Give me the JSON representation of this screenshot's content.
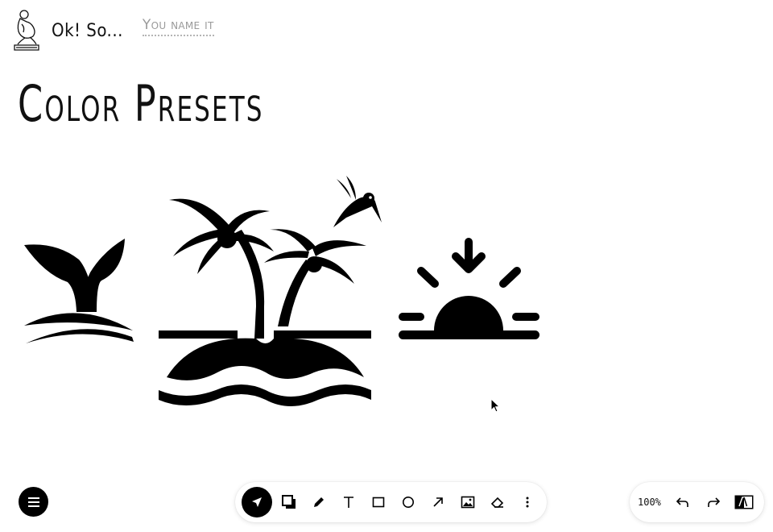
{
  "app": {
    "name": "Ok! So...",
    "board_name": "You name it"
  },
  "page": {
    "title": "Color Presets"
  },
  "canvas": {
    "shapes": [
      "whale-tail-icon",
      "palm-island-icon",
      "hummingbird-icon",
      "sunset-icon"
    ]
  },
  "toolbar": {
    "tools": [
      {
        "name": "select",
        "icon": "arrow-pointer-icon",
        "active": true
      },
      {
        "name": "color",
        "icon": "color-swatch-icon"
      },
      {
        "name": "pen",
        "icon": "pencil-icon"
      },
      {
        "name": "text",
        "icon": "text-icon",
        "label": "T"
      },
      {
        "name": "rectangle",
        "icon": "rectangle-icon"
      },
      {
        "name": "ellipse",
        "icon": "circle-icon"
      },
      {
        "name": "arrow",
        "icon": "arrow-icon"
      },
      {
        "name": "image",
        "icon": "image-icon"
      },
      {
        "name": "eraser",
        "icon": "eraser-icon"
      },
      {
        "name": "more",
        "icon": "more-vertical-icon"
      }
    ]
  },
  "zoom": {
    "level": "100%"
  },
  "theme": {
    "ink": "#000000",
    "muted": "#9a9a9a"
  }
}
